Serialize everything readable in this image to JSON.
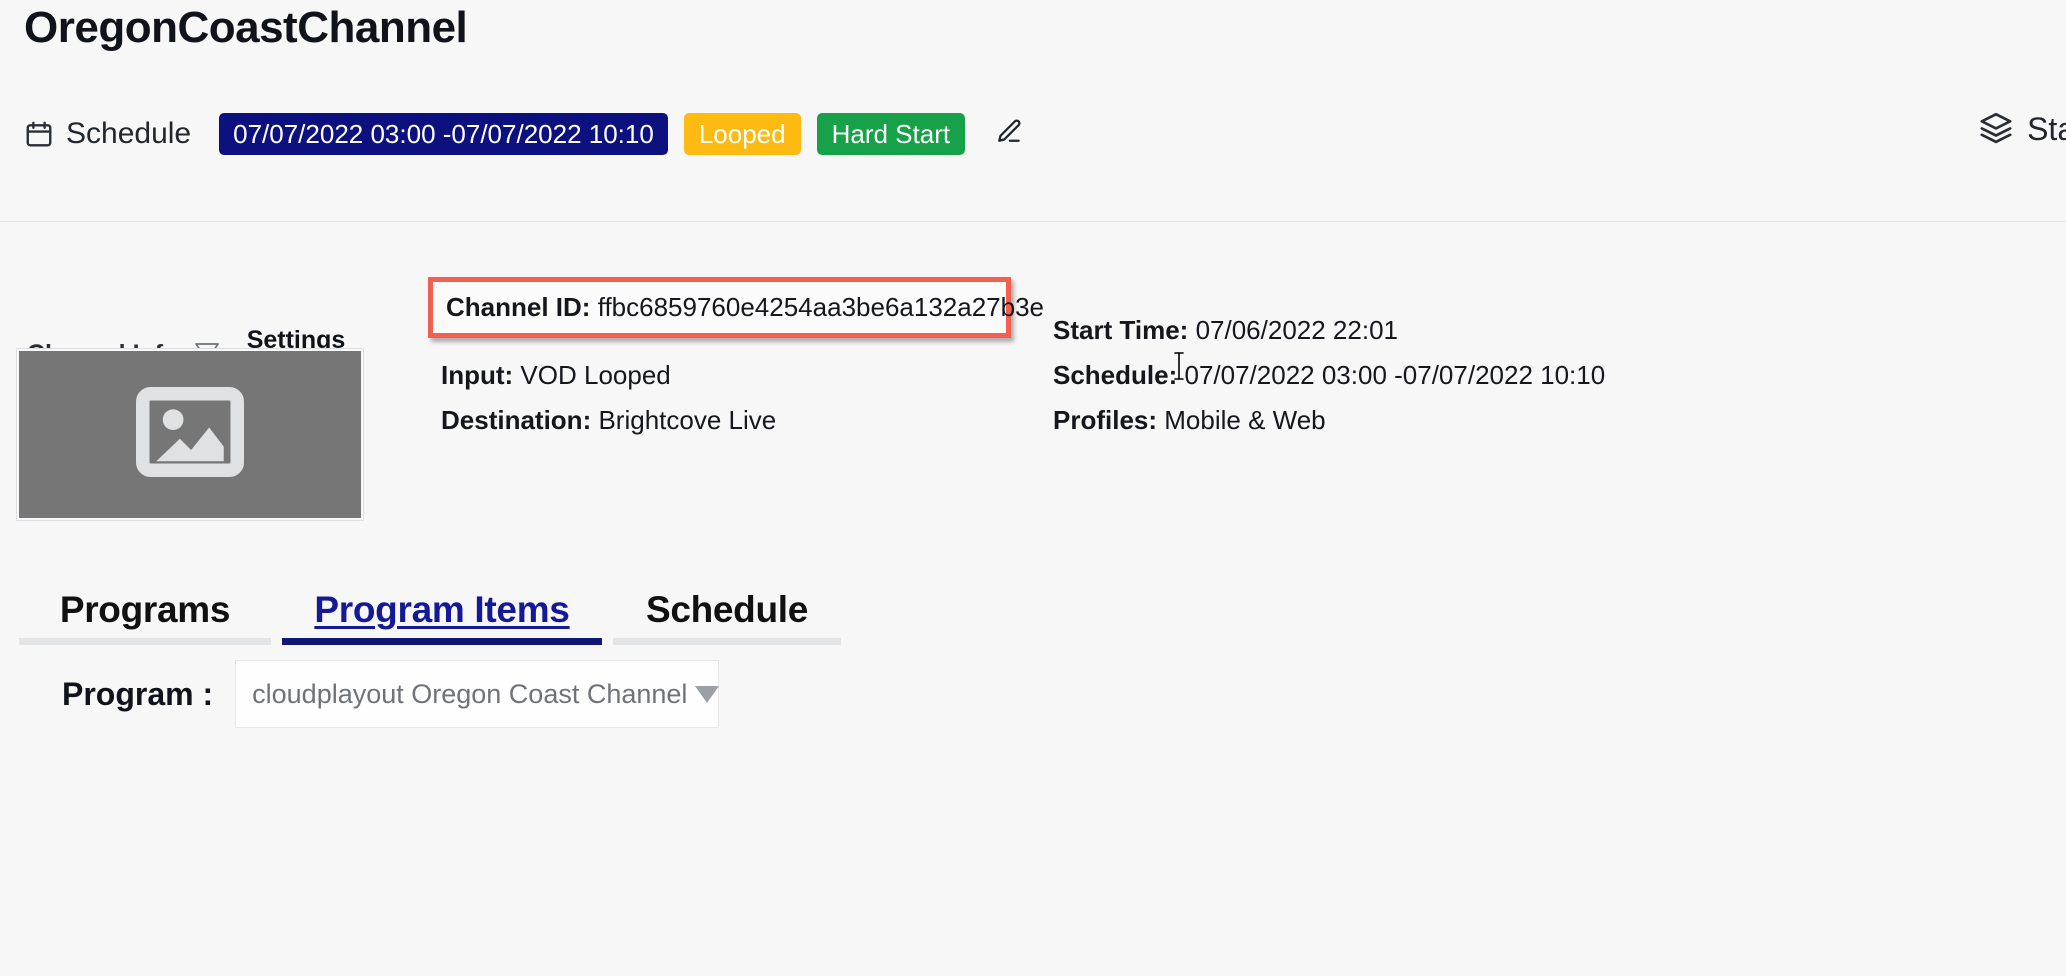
{
  "header": {
    "channel_title": "OregonCoastChannel",
    "schedule_icon": "calendar-icon",
    "schedule_label": "Schedule",
    "schedule_range_badge": "07/07/2022 03:00 -07/07/2022 10:10",
    "looped_badge": "Looped",
    "hard_start_badge": "Hard Start",
    "edit_icon": "pencil-icon",
    "status_icon": "layers-icon",
    "status_label": "Stat",
    "colors": {
      "range_badge_bg": "#0d1180",
      "looped_badge_bg": "#fdbb11",
      "hard_start_badge_bg": "#17a24a",
      "accent": "#111775",
      "highlight_border": "#f4604f"
    }
  },
  "info_tabs": {
    "channel_info_label": "Channel Info",
    "channel_info_caret_icon": "triangle-down-icon",
    "settings_label": "Settings"
  },
  "thumbnail": {
    "placeholder_icon": "image-placeholder-icon"
  },
  "details": {
    "left": [
      {
        "label": "Channel ID:",
        "value": "ffbc6859760e4254aa3be6a132a27b3e",
        "highlighted": true
      },
      {
        "label": "Input:",
        "value": "VOD Looped"
      },
      {
        "label": "Destination:",
        "value": "Brightcove Live"
      }
    ],
    "right": [
      {
        "label": "Start Time:",
        "value": "07/06/2022 22:01"
      },
      {
        "label": "Schedule:",
        "value": "07/07/2022 03:00 -07/07/2022 10:10"
      },
      {
        "label": "Profiles:",
        "value": "Mobile & Web"
      }
    ]
  },
  "bottom_tabs": [
    {
      "label": "Programs",
      "active": false
    },
    {
      "label": "Program Items",
      "active": true
    },
    {
      "label": "Schedule",
      "active": false
    }
  ],
  "program_selector": {
    "label": "Program :",
    "value": "cloudplayout Oregon Coast Channel",
    "caret_icon": "caret-down-icon"
  },
  "cursor": {
    "type": "text-ibeam"
  }
}
